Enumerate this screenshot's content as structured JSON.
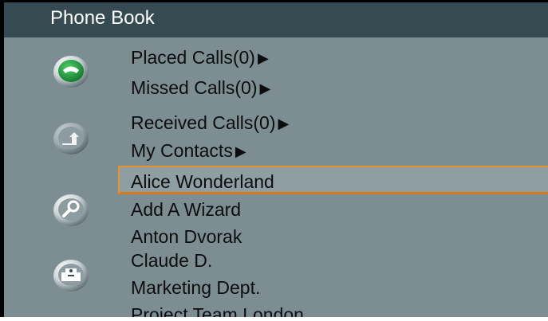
{
  "header": {
    "title": "Phone Book"
  },
  "icons": [
    "phone-icon",
    "upload-icon",
    "search-icon",
    "contact-card-icon"
  ],
  "menu": [
    {
      "label": "Placed Calls(0)",
      "arrow": "▶"
    },
    {
      "label": "Missed Calls(0)",
      "arrow": "▶"
    },
    {
      "label": "Received Calls(0)",
      "arrow": "▶"
    },
    {
      "label": "My Contacts",
      "arrow": "▶"
    }
  ],
  "contacts": [
    {
      "label": "Alice Wonderland",
      "selected": true
    },
    {
      "label": "Add A Wizard"
    },
    {
      "label": "Anton Dvorak"
    },
    {
      "label": "Claude D."
    },
    {
      "label": "Marketing Dept."
    },
    {
      "label": "Project Team London"
    }
  ],
  "colors": {
    "accent": "#e8922d",
    "header": "#354b51",
    "background": "#7d8e92",
    "phone_icon": "#1f9a38"
  }
}
